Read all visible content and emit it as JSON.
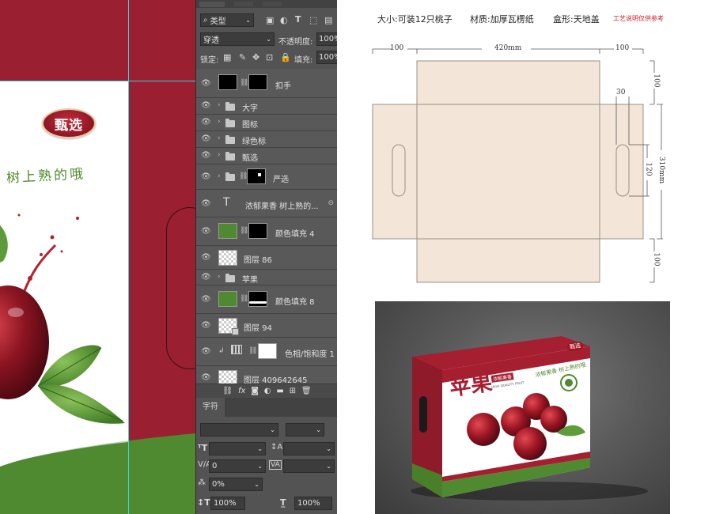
{
  "canvas": {
    "badge_text": "甄选",
    "slogan": "树上熟的哦",
    "colors": {
      "bg": "#9a1f30",
      "green": "#4f8a30",
      "guide": "#35d7e0"
    }
  },
  "ps_panel": {
    "top_tabs": [
      "",
      "",
      ""
    ],
    "filter": {
      "icon": "search-icon",
      "label": "类型"
    },
    "blend_mode": "穿透",
    "opacity_label": "不透明度:",
    "opacity_value": "100%",
    "lock_label": "锁定:",
    "fill_label": "填充:",
    "fill_value": "100%",
    "layers": [
      {
        "name": "扣手",
        "kind": "mask-layer"
      },
      {
        "name": "大字",
        "kind": "group"
      },
      {
        "name": "图标",
        "kind": "group"
      },
      {
        "name": "绿色标",
        "kind": "group"
      },
      {
        "name": "甄选",
        "kind": "group"
      },
      {
        "name": "严选",
        "kind": "group-mask"
      },
      {
        "name": "浓郁果香 树上熟的...",
        "kind": "text"
      },
      {
        "name": "颜色填充 4",
        "kind": "fill"
      },
      {
        "name": "图层 86",
        "kind": "pixel"
      },
      {
        "name": "苹果",
        "kind": "group"
      },
      {
        "name": "颜色填充 8",
        "kind": "fill"
      },
      {
        "name": "图层 94",
        "kind": "pixel"
      },
      {
        "name": "色相/饱和度 1",
        "kind": "adjustment"
      },
      {
        "name": "图层 409642645",
        "kind": "pixel"
      }
    ],
    "char_tab": "字符",
    "char_fields": {
      "tracking": "0",
      "scale": "0%",
      "horiz_scale": "100%",
      "vert_scale": "100%"
    }
  },
  "specs": {
    "size_label": "大小:",
    "size_value": "可装12只桃子",
    "material_label": "材质:",
    "material_value": "加厚瓦楞纸",
    "box_label": "盒形:",
    "box_value": "天地盖",
    "note": "工艺说明仅供参考",
    "dims": {
      "left_flap": "100",
      "width": "420mm",
      "right_flap": "100",
      "top": "100",
      "tab": "30",
      "handle": "120",
      "height": "310mm",
      "bottom": "100"
    },
    "colors": {
      "die_fill": "#f3e6d8",
      "die_line": "#9a8f87",
      "note": "#c8202a"
    }
  },
  "mockup": {
    "badge": "甄选",
    "title": "苹果",
    "tag": "浓郁果香",
    "sub_en": "HIGH QUALITY FRUIT",
    "slogan": "浓郁果香 树上熟的哦"
  }
}
